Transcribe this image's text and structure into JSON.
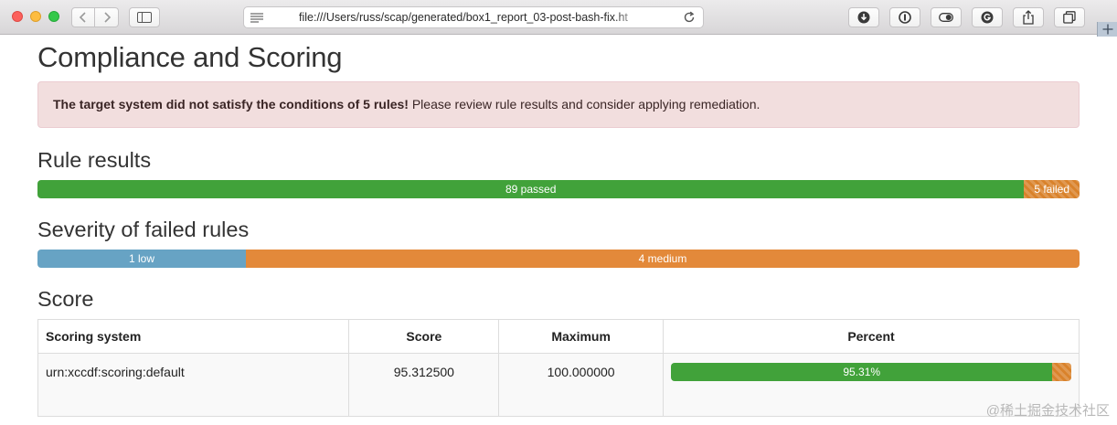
{
  "browser": {
    "url": "file:///Users/russ/scap/generated/box1_report_03-post-bash-fix.ht"
  },
  "page": {
    "title": "Compliance and Scoring",
    "alert": {
      "bold": "The target system did not satisfy the conditions of 5 rules!",
      "text": " Please review rule results and consider applying remediation."
    },
    "rule_results": {
      "heading": "Rule results",
      "passed_label": "89 passed",
      "failed_label": "5 failed",
      "passed": 89,
      "failed": 5
    },
    "severity": {
      "heading": "Severity of failed rules",
      "low_label": "1 low",
      "medium_label": "4 medium",
      "low": 1,
      "medium": 4
    },
    "score": {
      "heading": "Score",
      "columns": [
        "Scoring system",
        "Score",
        "Maximum",
        "Percent"
      ],
      "row": {
        "system": "urn:xccdf:scoring:default",
        "score": "95.312500",
        "maximum": "100.000000",
        "percent_label": "95.31%",
        "percent": 95.31
      }
    }
  },
  "colors": {
    "passed": "#41a23a",
    "failed": "#d9822b",
    "low": "#67a3c4",
    "medium": "#e3893a",
    "alert_bg": "#f2dede"
  },
  "watermark": "@稀土掘金技术社区"
}
